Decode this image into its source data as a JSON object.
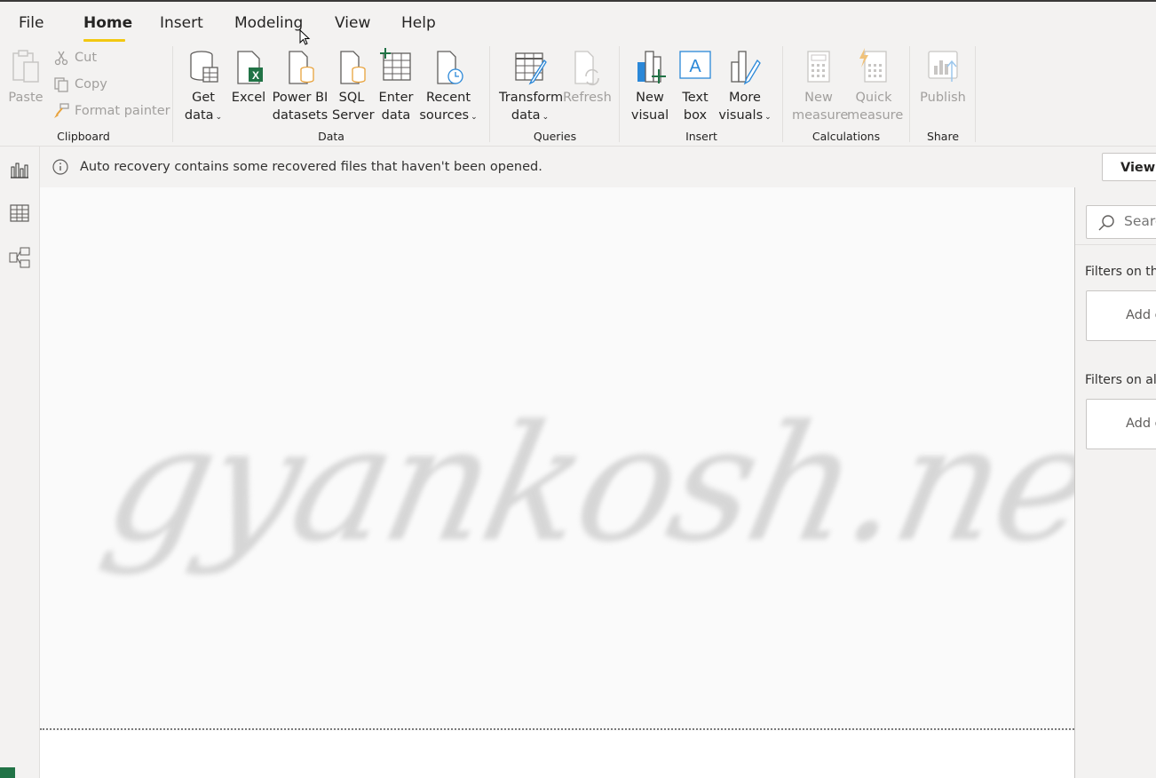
{
  "tabs": [
    "File",
    "Home",
    "Insert",
    "Modeling",
    "View",
    "Help"
  ],
  "ribbon": {
    "clipboard": {
      "paste": "Paste",
      "cut": "Cut",
      "copy": "Copy",
      "format_painter": "Format painter",
      "label": "Clipboard"
    },
    "data": {
      "get_data": [
        "Get",
        "data"
      ],
      "excel": "Excel",
      "power_bi_datasets": [
        "Power BI",
        "datasets"
      ],
      "sql_server": [
        "SQL",
        "Server"
      ],
      "enter_data": [
        "Enter",
        "data"
      ],
      "recent_sources": [
        "Recent",
        "sources"
      ],
      "label": "Data"
    },
    "queries": {
      "transform_data": [
        "Transform",
        "data"
      ],
      "refresh": "Refresh",
      "label": "Queries"
    },
    "insert": {
      "new_visual": [
        "New",
        "visual"
      ],
      "text_box": [
        "Text",
        "box"
      ],
      "more_visuals": [
        "More",
        "visuals"
      ],
      "label": "Insert"
    },
    "calculations": {
      "new_measure": [
        "New",
        "measure"
      ],
      "quick_measure": [
        "Quick",
        "measure"
      ],
      "label": "Calculations"
    },
    "share": {
      "publish": "Publish",
      "label": "Share"
    }
  },
  "notification": {
    "text": "Auto recovery contains some recovered files that haven't been opened.",
    "button": "View r"
  },
  "watermark": "gyankosh.net",
  "filters": {
    "search_placeholder": "Search",
    "on_this_page": "Filters on this page",
    "on_all_pages": "Filters on all pages",
    "add_data_fields": "Add data fields here"
  },
  "colors": {
    "accent_underline": "#f2c811",
    "excel_green": "#217346",
    "icon_blue": "#2b88d8",
    "icon_orange": "#e8a33d"
  }
}
